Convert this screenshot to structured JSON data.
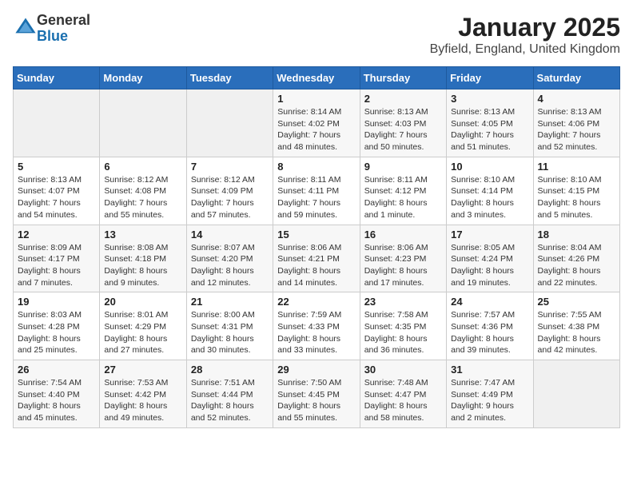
{
  "logo": {
    "general": "General",
    "blue": "Blue"
  },
  "title": "January 2025",
  "subtitle": "Byfield, England, United Kingdom",
  "weekdays": [
    "Sunday",
    "Monday",
    "Tuesday",
    "Wednesday",
    "Thursday",
    "Friday",
    "Saturday"
  ],
  "weeks": [
    [
      {
        "day": "",
        "detail": ""
      },
      {
        "day": "",
        "detail": ""
      },
      {
        "day": "",
        "detail": ""
      },
      {
        "day": "1",
        "detail": "Sunrise: 8:14 AM\nSunset: 4:02 PM\nDaylight: 7 hours\nand 48 minutes."
      },
      {
        "day": "2",
        "detail": "Sunrise: 8:13 AM\nSunset: 4:03 PM\nDaylight: 7 hours\nand 50 minutes."
      },
      {
        "day": "3",
        "detail": "Sunrise: 8:13 AM\nSunset: 4:05 PM\nDaylight: 7 hours\nand 51 minutes."
      },
      {
        "day": "4",
        "detail": "Sunrise: 8:13 AM\nSunset: 4:06 PM\nDaylight: 7 hours\nand 52 minutes."
      }
    ],
    [
      {
        "day": "5",
        "detail": "Sunrise: 8:13 AM\nSunset: 4:07 PM\nDaylight: 7 hours\nand 54 minutes."
      },
      {
        "day": "6",
        "detail": "Sunrise: 8:12 AM\nSunset: 4:08 PM\nDaylight: 7 hours\nand 55 minutes."
      },
      {
        "day": "7",
        "detail": "Sunrise: 8:12 AM\nSunset: 4:09 PM\nDaylight: 7 hours\nand 57 minutes."
      },
      {
        "day": "8",
        "detail": "Sunrise: 8:11 AM\nSunset: 4:11 PM\nDaylight: 7 hours\nand 59 minutes."
      },
      {
        "day": "9",
        "detail": "Sunrise: 8:11 AM\nSunset: 4:12 PM\nDaylight: 8 hours\nand 1 minute."
      },
      {
        "day": "10",
        "detail": "Sunrise: 8:10 AM\nSunset: 4:14 PM\nDaylight: 8 hours\nand 3 minutes."
      },
      {
        "day": "11",
        "detail": "Sunrise: 8:10 AM\nSunset: 4:15 PM\nDaylight: 8 hours\nand 5 minutes."
      }
    ],
    [
      {
        "day": "12",
        "detail": "Sunrise: 8:09 AM\nSunset: 4:17 PM\nDaylight: 8 hours\nand 7 minutes."
      },
      {
        "day": "13",
        "detail": "Sunrise: 8:08 AM\nSunset: 4:18 PM\nDaylight: 8 hours\nand 9 minutes."
      },
      {
        "day": "14",
        "detail": "Sunrise: 8:07 AM\nSunset: 4:20 PM\nDaylight: 8 hours\nand 12 minutes."
      },
      {
        "day": "15",
        "detail": "Sunrise: 8:06 AM\nSunset: 4:21 PM\nDaylight: 8 hours\nand 14 minutes."
      },
      {
        "day": "16",
        "detail": "Sunrise: 8:06 AM\nSunset: 4:23 PM\nDaylight: 8 hours\nand 17 minutes."
      },
      {
        "day": "17",
        "detail": "Sunrise: 8:05 AM\nSunset: 4:24 PM\nDaylight: 8 hours\nand 19 minutes."
      },
      {
        "day": "18",
        "detail": "Sunrise: 8:04 AM\nSunset: 4:26 PM\nDaylight: 8 hours\nand 22 minutes."
      }
    ],
    [
      {
        "day": "19",
        "detail": "Sunrise: 8:03 AM\nSunset: 4:28 PM\nDaylight: 8 hours\nand 25 minutes."
      },
      {
        "day": "20",
        "detail": "Sunrise: 8:01 AM\nSunset: 4:29 PM\nDaylight: 8 hours\nand 27 minutes."
      },
      {
        "day": "21",
        "detail": "Sunrise: 8:00 AM\nSunset: 4:31 PM\nDaylight: 8 hours\nand 30 minutes."
      },
      {
        "day": "22",
        "detail": "Sunrise: 7:59 AM\nSunset: 4:33 PM\nDaylight: 8 hours\nand 33 minutes."
      },
      {
        "day": "23",
        "detail": "Sunrise: 7:58 AM\nSunset: 4:35 PM\nDaylight: 8 hours\nand 36 minutes."
      },
      {
        "day": "24",
        "detail": "Sunrise: 7:57 AM\nSunset: 4:36 PM\nDaylight: 8 hours\nand 39 minutes."
      },
      {
        "day": "25",
        "detail": "Sunrise: 7:55 AM\nSunset: 4:38 PM\nDaylight: 8 hours\nand 42 minutes."
      }
    ],
    [
      {
        "day": "26",
        "detail": "Sunrise: 7:54 AM\nSunset: 4:40 PM\nDaylight: 8 hours\nand 45 minutes."
      },
      {
        "day": "27",
        "detail": "Sunrise: 7:53 AM\nSunset: 4:42 PM\nDaylight: 8 hours\nand 49 minutes."
      },
      {
        "day": "28",
        "detail": "Sunrise: 7:51 AM\nSunset: 4:44 PM\nDaylight: 8 hours\nand 52 minutes."
      },
      {
        "day": "29",
        "detail": "Sunrise: 7:50 AM\nSunset: 4:45 PM\nDaylight: 8 hours\nand 55 minutes."
      },
      {
        "day": "30",
        "detail": "Sunrise: 7:48 AM\nSunset: 4:47 PM\nDaylight: 8 hours\nand 58 minutes."
      },
      {
        "day": "31",
        "detail": "Sunrise: 7:47 AM\nSunset: 4:49 PM\nDaylight: 9 hours\nand 2 minutes."
      },
      {
        "day": "",
        "detail": ""
      }
    ]
  ]
}
